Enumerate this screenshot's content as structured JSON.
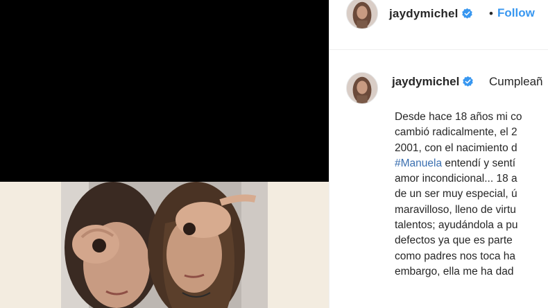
{
  "post": {
    "username": "jaydymichel",
    "separator": "•",
    "follow_label": "Follow"
  },
  "caption": {
    "username": "jaydymichel",
    "first_line": "Cumpleañ",
    "lines": [
      "Desde hace 18 años mi co",
      "cambió radicalmente, el 2",
      "2001, con el nacimiento d"
    ],
    "hashtag": "#Manuela",
    "hashtag_rest": " entendí y sentí",
    "lines_after": [
      "amor incondicional... 18 a",
      "de un ser muy especial, ú",
      "maravilloso, lleno de virtu",
      "talentos; ayudándola a pu",
      "defectos ya que es parte",
      "como padres nos toca ha",
      "embargo, ella me ha dad"
    ]
  },
  "colors": {
    "link_blue": "#3897f0",
    "hashtag_blue": "#3a6fb0",
    "text": "#262626",
    "media_bg": "#000000",
    "beige": "#f3ece0"
  },
  "icons": {
    "verified": "verified-badge-icon"
  }
}
